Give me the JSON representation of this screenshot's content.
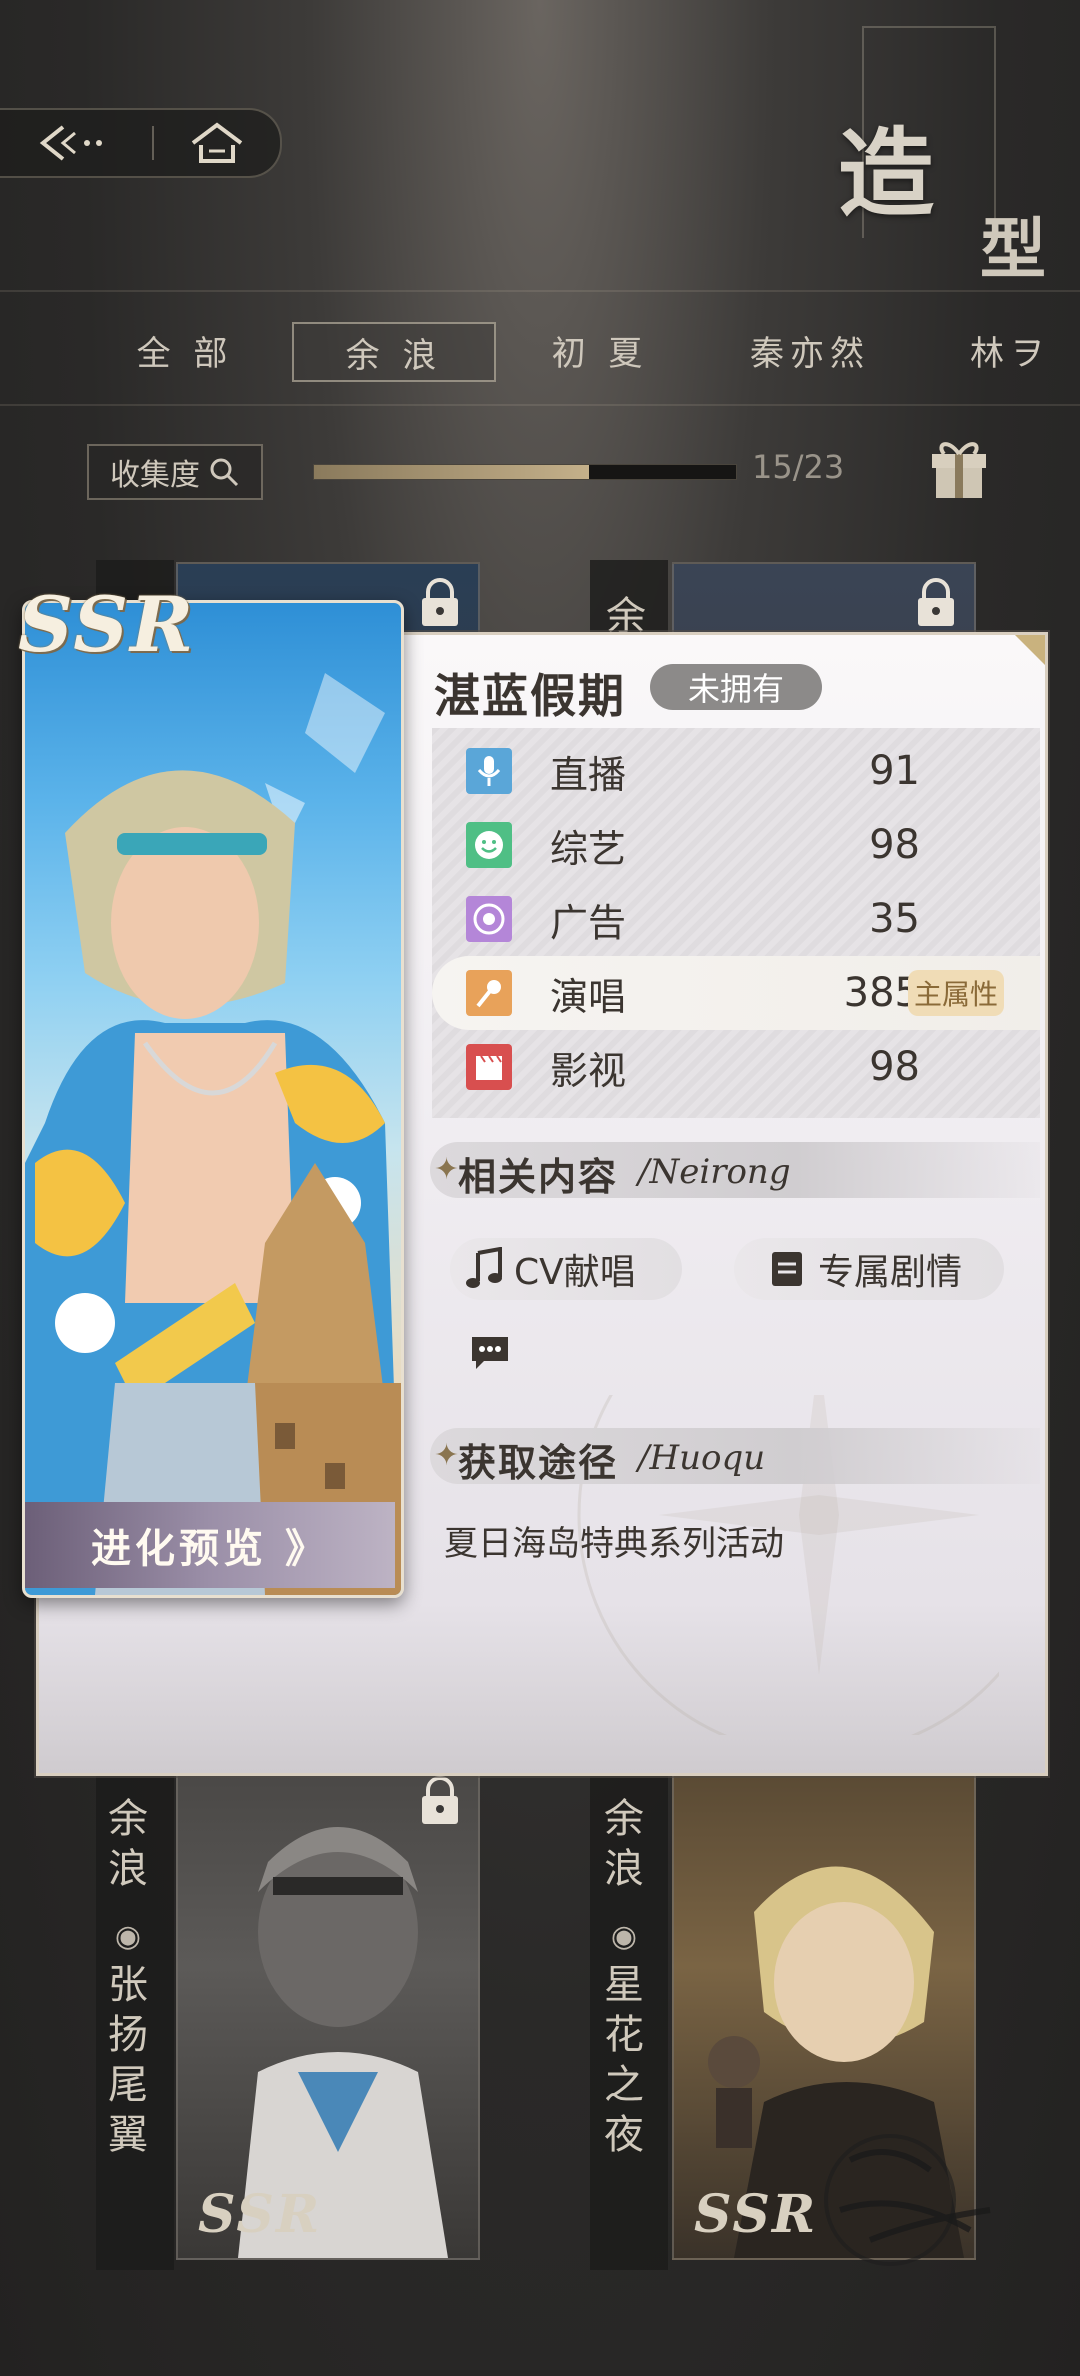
{
  "page": {
    "title_part1": "造",
    "title_part2": "型"
  },
  "tabs": [
    "全 部",
    "余 浪",
    "初 夏",
    "秦亦然",
    "林ヲ"
  ],
  "collection": {
    "label": "收集度",
    "progress_fraction": 0.652,
    "progress_text": "15/23"
  },
  "grid": {
    "card1_name": "余",
    "card2_name": "余",
    "card3_char": "余\n浪",
    "card3_title": "张\n扬\n尾\n翼",
    "card4_char": "余\n浪",
    "card4_title": "星\n花\n之\n夜",
    "ssr": "SSR"
  },
  "detail": {
    "rarity": "SSR",
    "name": "湛蓝假期",
    "owned_status": "未拥有",
    "evolve_label": "进化预览 》",
    "stats": [
      {
        "label": "直播",
        "value": "91",
        "icon": "microphone-icon",
        "color": "#5aa6d8"
      },
      {
        "label": "综艺",
        "value": "98",
        "icon": "smile-icon",
        "color": "#4fbf85"
      },
      {
        "label": "广告",
        "value": "35",
        "icon": "ad-circle-icon",
        "color": "#b486d8"
      },
      {
        "label": "演唱",
        "value": "385",
        "icon": "mic-singing-icon",
        "color": "#e8a25a",
        "main": true,
        "badge": "主属性"
      },
      {
        "label": "影视",
        "value": "98",
        "icon": "clapperboard-icon",
        "color": "#d84f4f"
      }
    ],
    "related": {
      "title": "相关内容",
      "subtitle": "/Neirong",
      "cv_label": "CV献唱",
      "story_label": "专属剧情"
    },
    "acquire": {
      "title": "获取途径",
      "subtitle": "/Huoqu",
      "text": "夏日海岛特典系列活动"
    }
  }
}
